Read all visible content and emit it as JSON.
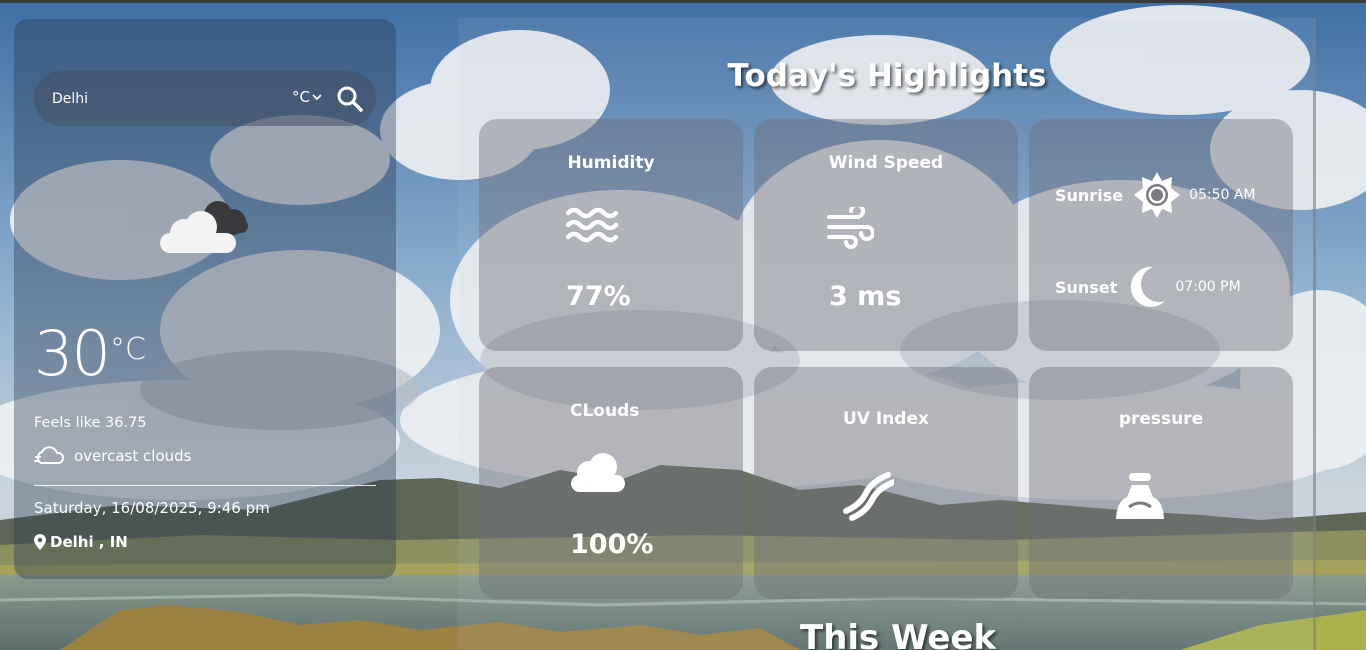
{
  "search": {
    "placeholder": "Delhi",
    "unit": "°C"
  },
  "current": {
    "icon": "cloud-overcast-icon",
    "temperature": "30",
    "unit": "°C",
    "feels_like": "Feels like 36.75",
    "description": "overcast clouds",
    "datetime": "Saturday, 16/08/2025, 9:46 pm",
    "location": "Delhi , IN"
  },
  "highlights": {
    "title": "Today's Highlights",
    "humidity": {
      "label": "Humidity",
      "value": "77%",
      "icon": "humidity-waves-icon"
    },
    "wind": {
      "label": "Wind Speed",
      "value": "3 ms",
      "icon": "wind-icon"
    },
    "sun": {
      "sunrise_label": "Sunrise",
      "sunrise_time": "05:50 AM",
      "sunrise_icon": "sun-icon",
      "sunset_label": "Sunset",
      "sunset_time": "07:00 PM",
      "sunset_icon": "moon-icon"
    },
    "clouds": {
      "label": "CLouds",
      "value": "100%",
      "icon": "cloud-icon"
    },
    "uv": {
      "label": "UV Index",
      "icon": "uv-index-icon"
    },
    "pressure": {
      "label": "pressure",
      "icon": "pressure-volcano-icon"
    }
  },
  "week": {
    "title": "This Week"
  },
  "colors": {
    "sky": "#6f8fb5",
    "panel": "#283750",
    "card": "#6e6e78"
  }
}
